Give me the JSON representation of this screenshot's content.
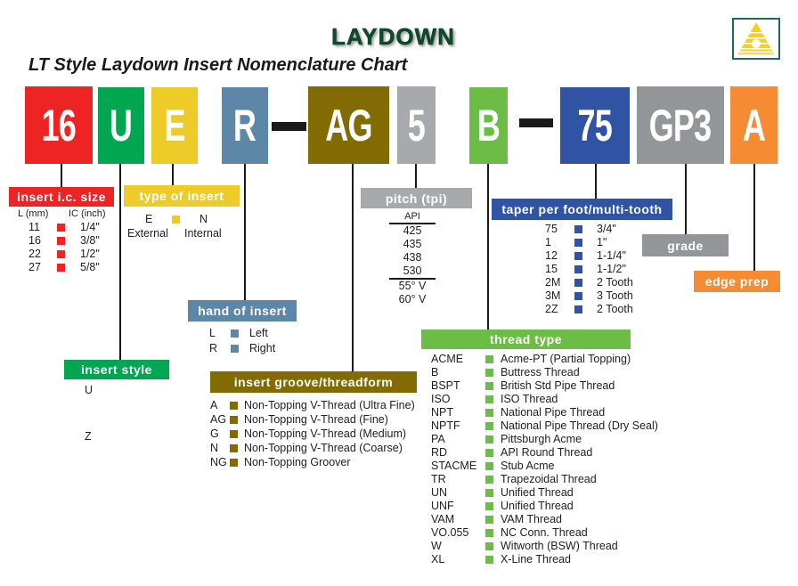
{
  "header": {
    "title": "LAYDOWN",
    "subtitle": "LT Style Laydown Insert Nomenclature Chart",
    "logo_icon": "triangle-logo-icon"
  },
  "colors": {
    "ic_size": "#ee2424",
    "style": "#00a650",
    "type": "#edcc2a",
    "hand": "#5d87a6",
    "groove": "#836b03",
    "pitch": "#a7a9ac",
    "thread": "#6cbd45",
    "taper": "#3153a4",
    "grade": "#939598",
    "edge": "#f58c34"
  },
  "code_boxes": [
    {
      "key": "ic_size",
      "code": "16"
    },
    {
      "key": "style",
      "code": "U"
    },
    {
      "key": "type",
      "code": "E"
    },
    {
      "key": "hand",
      "code": "R"
    },
    {
      "key": "groove",
      "code": "AG"
    },
    {
      "key": "pitch",
      "code": "5"
    },
    {
      "key": "thread",
      "code": "B"
    },
    {
      "key": "taper",
      "code": "75"
    },
    {
      "key": "grade",
      "code": "GP3"
    },
    {
      "key": "edge",
      "code": "A"
    }
  ],
  "ic_size": {
    "label": "insert i.c. size",
    "col1": "L (mm)",
    "col2": "IC (inch)",
    "rows": [
      {
        "mm": "11",
        "inch": "1/4\""
      },
      {
        "mm": "16",
        "inch": "3/8\""
      },
      {
        "mm": "22",
        "inch": "1/2\""
      },
      {
        "mm": "27",
        "inch": "5/8\""
      }
    ]
  },
  "insert_type": {
    "label": "type of insert",
    "left_code": "E",
    "left_desc": "External",
    "right_code": "N",
    "right_desc": "Internal"
  },
  "insert_style": {
    "label": "insert style",
    "values": [
      "U",
      "Z"
    ]
  },
  "hand": {
    "label": "hand of insert",
    "rows": [
      {
        "code": "L",
        "desc": "Left"
      },
      {
        "code": "R",
        "desc": "Right"
      }
    ]
  },
  "groove": {
    "label": "insert groove/threadform",
    "rows": [
      {
        "code": "A",
        "desc": "Non-Topping V-Thread (Ultra Fine)"
      },
      {
        "code": "AG",
        "desc": "Non-Topping V-Thread (Fine)"
      },
      {
        "code": "G",
        "desc": "Non-Topping V-Thread (Medium)"
      },
      {
        "code": "N",
        "desc": "Non-Topping V-Thread (Coarse)"
      },
      {
        "code": "NG",
        "desc": "Non-Topping Groover"
      }
    ]
  },
  "pitch": {
    "label": "pitch (tpi)",
    "heading": "API",
    "api_values": [
      "425",
      "435",
      "438",
      "530"
    ],
    "other_values": [
      "55° V",
      "60° V"
    ]
  },
  "taper": {
    "label": "taper per foot/multi-tooth",
    "rows": [
      {
        "code": "75",
        "desc": "3/4\""
      },
      {
        "code": "1",
        "desc": "1\""
      },
      {
        "code": "12",
        "desc": "1-1/4\""
      },
      {
        "code": "15",
        "desc": "1-1/2\""
      },
      {
        "code": "2M",
        "desc": "2 Tooth"
      },
      {
        "code": "3M",
        "desc": "3 Tooth"
      },
      {
        "code": "2Z",
        "desc": "2 Tooth"
      }
    ]
  },
  "grade": {
    "label": "grade"
  },
  "edge": {
    "label": "edge prep"
  },
  "thread": {
    "label": "thread type",
    "rows": [
      {
        "code": "ACME",
        "desc": "Acme-PT (Partial Topping)"
      },
      {
        "code": "B",
        "desc": "Buttress Thread"
      },
      {
        "code": "BSPT",
        "desc": "British Std Pipe Thread"
      },
      {
        "code": "ISO",
        "desc": "ISO Thread"
      },
      {
        "code": "NPT",
        "desc": "National Pipe Thread"
      },
      {
        "code": "NPTF",
        "desc": "National Pipe Thread (Dry Seal)"
      },
      {
        "code": "PA",
        "desc": "Pittsburgh Acme"
      },
      {
        "code": "RD",
        "desc": "API Round Thread"
      },
      {
        "code": "STACME",
        "desc": "Stub Acme"
      },
      {
        "code": "TR",
        "desc": "Trapezoidal Thread"
      },
      {
        "code": "UN",
        "desc": "Unified Thread"
      },
      {
        "code": "UNF",
        "desc": "Unified Thread"
      },
      {
        "code": "VAM",
        "desc": "VAM Thread"
      },
      {
        "code": "VO.055",
        "desc": "NC Conn. Thread"
      },
      {
        "code": "W",
        "desc": "Witworth (BSW) Thread"
      },
      {
        "code": "XL",
        "desc": "X-Line Thread"
      }
    ]
  }
}
